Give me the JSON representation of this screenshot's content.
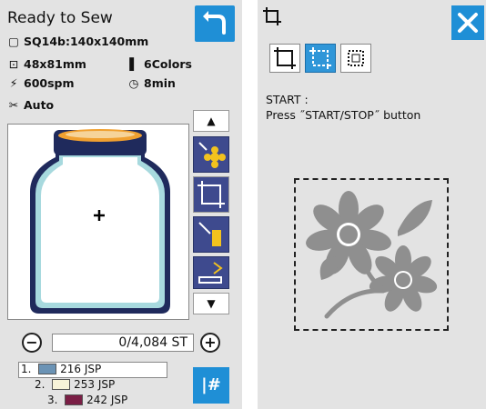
{
  "left": {
    "title": "Ready to Sew",
    "hoop": "SQ14b:140x140mm",
    "size": "48x81mm",
    "colors": "6Colors",
    "speed": "600spm",
    "time": "8min",
    "cut": "Auto",
    "stitch_count": "0/4,084 ST",
    "thread_list": [
      {
        "num": "1.",
        "label": "216 JSP",
        "color": "#6b93b5"
      },
      {
        "num": "2.",
        "label": "253 JSP",
        "color": "#f7f3d8"
      },
      {
        "num": "3.",
        "label": "242 JSP",
        "color": "#7a1e45"
      }
    ],
    "num_button": "|#",
    "icons": [
      "hoop-icon",
      "size-icon",
      "spool-icon",
      "speed-icon",
      "clock-icon",
      "scissors-icon"
    ]
  },
  "right": {
    "start_label": "START :",
    "start_instruction": "Press ˝START/STOP˝ button"
  },
  "colors": {
    "accent": "#1f8fd6",
    "panel": "#e3e3e3",
    "edit_button": "#3e4a8e",
    "flower": "#8f8f8f"
  }
}
